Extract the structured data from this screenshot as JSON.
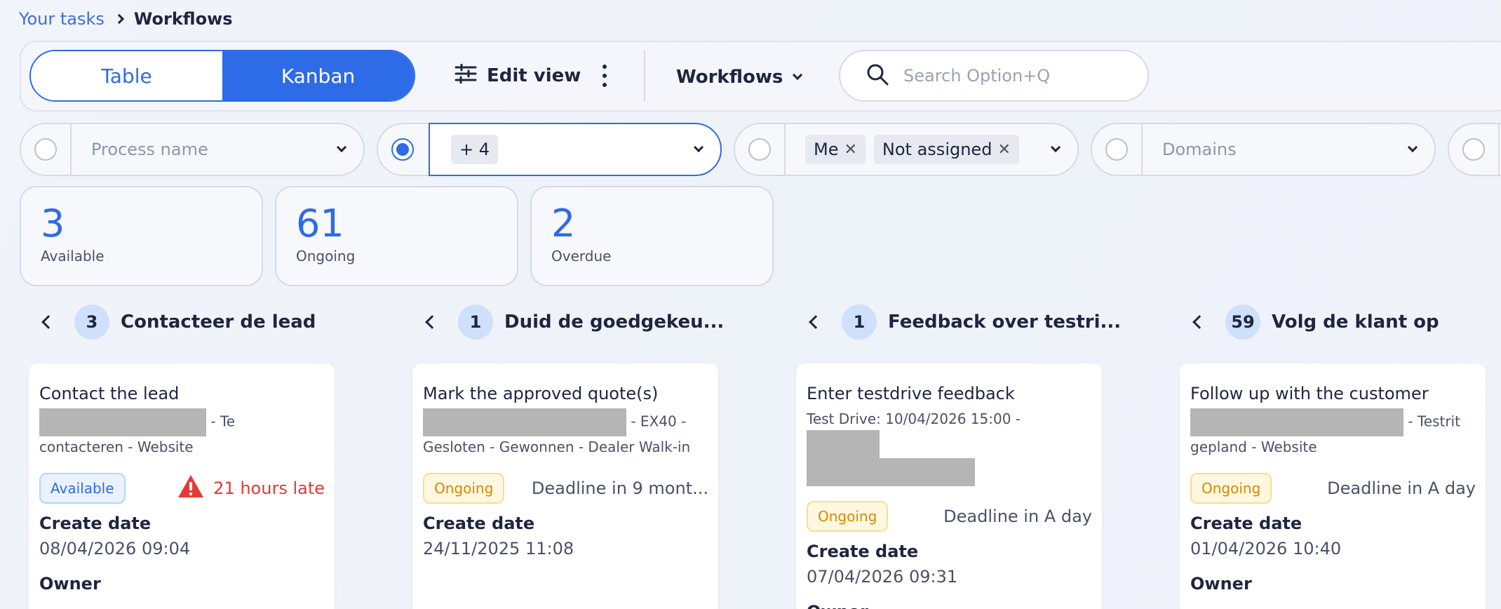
{
  "breadcrumb": {
    "parent": "Your tasks",
    "current": "Workflows"
  },
  "toolbar": {
    "view_toggle": {
      "table": "Table",
      "kanban": "Kanban",
      "active": "Kanban"
    },
    "edit_view": "Edit view",
    "workflows_dropdown": "Workflows",
    "search": {
      "placeholder": "Search Option+Q",
      "value": ""
    }
  },
  "filters": {
    "process": {
      "placeholder": "Process name",
      "selected": false
    },
    "status": {
      "tag": "+ 4",
      "selected": true
    },
    "assignee": {
      "tags": [
        "Me",
        "Not assigned"
      ],
      "selected": false
    },
    "domains": {
      "placeholder": "Domains",
      "selected": false
    }
  },
  "stats": [
    {
      "value": "3",
      "label": "Available"
    },
    {
      "value": "61",
      "label": "Ongoing"
    },
    {
      "value": "2",
      "label": "Overdue"
    }
  ],
  "columns": [
    {
      "count": "3",
      "title": "Contacteer de lead",
      "card": {
        "title": "Contact the lead",
        "subtitle_a": " - Te",
        "subtitle_b": "contacteren - Website",
        "status": "Available",
        "timing": "21 hours late",
        "create_label": "Create date",
        "create_value": "08/04/2026 09:04",
        "owner_label": "Owner"
      }
    },
    {
      "count": "1",
      "title": "Duid de goedgekeu...",
      "card": {
        "title": "Mark the approved quote(s)",
        "subtitle_a": " - EX40 -",
        "subtitle_b": "Gesloten - Gewonnen - Dealer Walk-in",
        "status": "Ongoing",
        "timing": "Deadline in 9 mont...",
        "create_label": "Create date",
        "create_value": "24/11/2025 11:08"
      }
    },
    {
      "count": "1",
      "title": "Feedback over testri...",
      "card": {
        "title": "Enter testdrive feedback",
        "subtitle_a": "Test Drive: 10/04/2026 15:00 -",
        "status": "Ongoing",
        "timing": "Deadline in A day",
        "create_label": "Create date",
        "create_value": "07/04/2026 09:31",
        "owner_label": "Owner"
      }
    },
    {
      "count": "59",
      "title": "Volg de klant op",
      "card": {
        "title": "Follow up with the customer",
        "subtitle_a": " - Testrit",
        "subtitle_b": "gepland - Website",
        "status": "Ongoing",
        "timing": "Deadline in A day",
        "create_label": "Create date",
        "create_value": "01/04/2026 10:40",
        "owner_label": "Owner"
      }
    }
  ],
  "colors": {
    "primary": "#2e6be6",
    "danger": "#e53935",
    "warning": "#d58a00",
    "text": "#1f2540"
  },
  "icons": [
    "chevron-right-icon",
    "sliders-icon",
    "kebab-icon",
    "chevron-down-icon",
    "search-icon",
    "close-icon",
    "chevron-left-icon",
    "warning-triangle-icon"
  ]
}
